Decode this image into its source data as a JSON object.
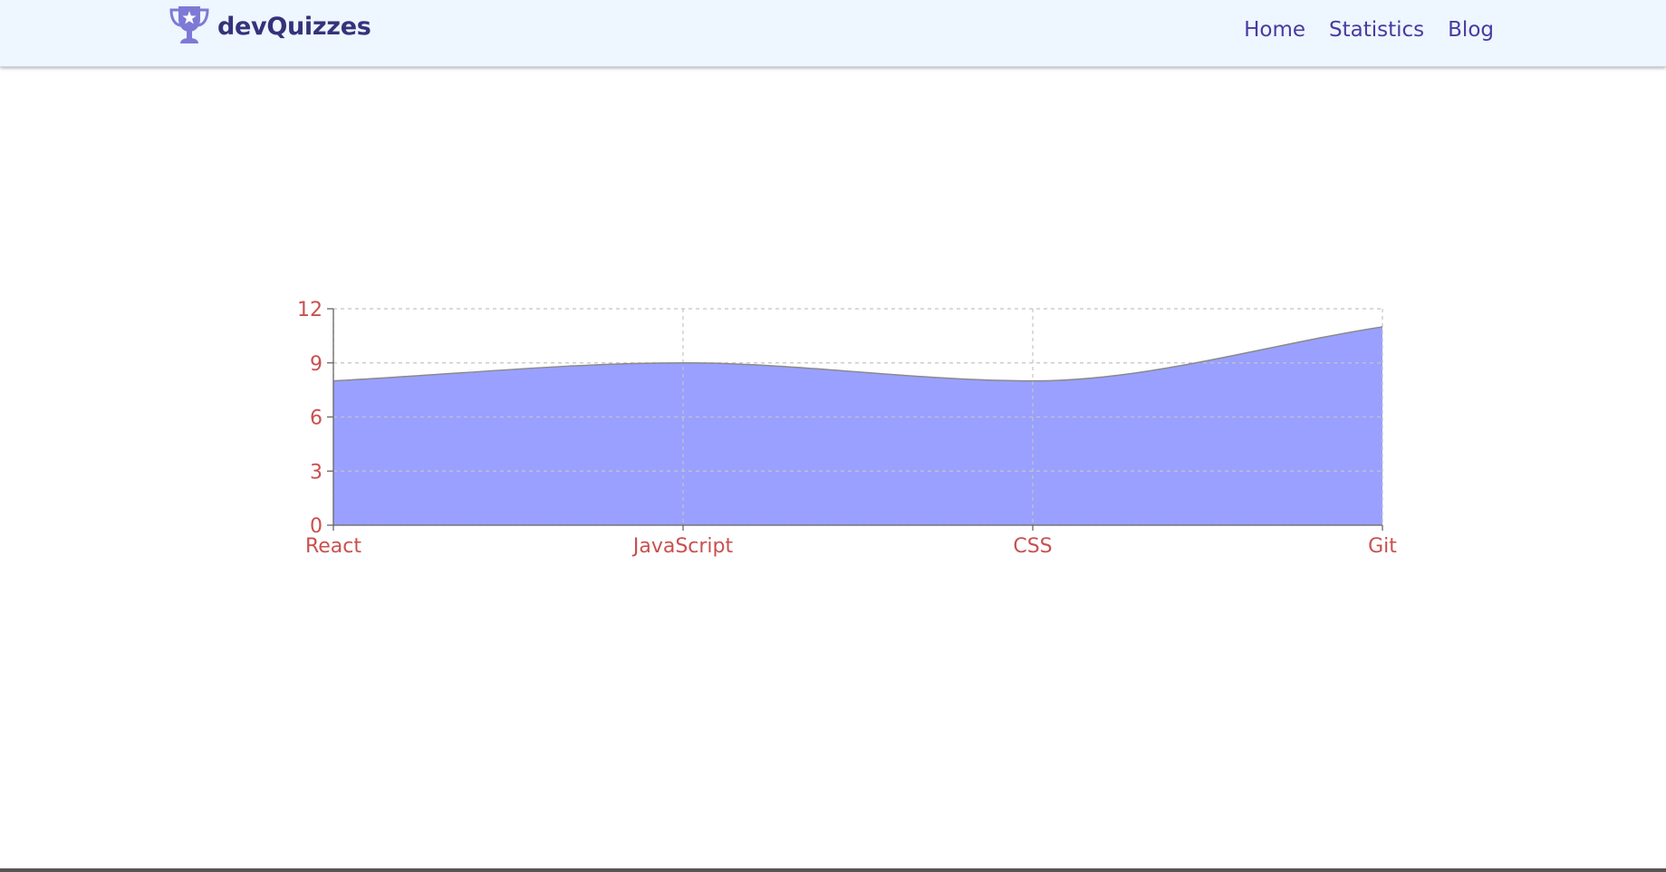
{
  "navbar": {
    "brand_name": "devQuizzes",
    "logo_icon": "trophy-star-icon",
    "links": [
      "Home",
      "Statistics",
      "Blog"
    ]
  },
  "colors": {
    "navbar_bg": "#eef6ff",
    "brand": "#34327a",
    "nav_link": "#4a3aa0",
    "area_fill": "#9aa0ff",
    "area_stroke": "#8a8a8a",
    "tick_label": "#c9504f"
  },
  "chart_data": {
    "type": "area",
    "title": "",
    "xlabel": "",
    "ylabel": "",
    "categories": [
      "React",
      "JavaScript",
      "CSS",
      "Git"
    ],
    "values": [
      8,
      9,
      8,
      11
    ],
    "ylim": [
      0,
      12
    ],
    "yticks": [
      0,
      3,
      6,
      9,
      12
    ],
    "grid": true,
    "curve": "smooth"
  }
}
